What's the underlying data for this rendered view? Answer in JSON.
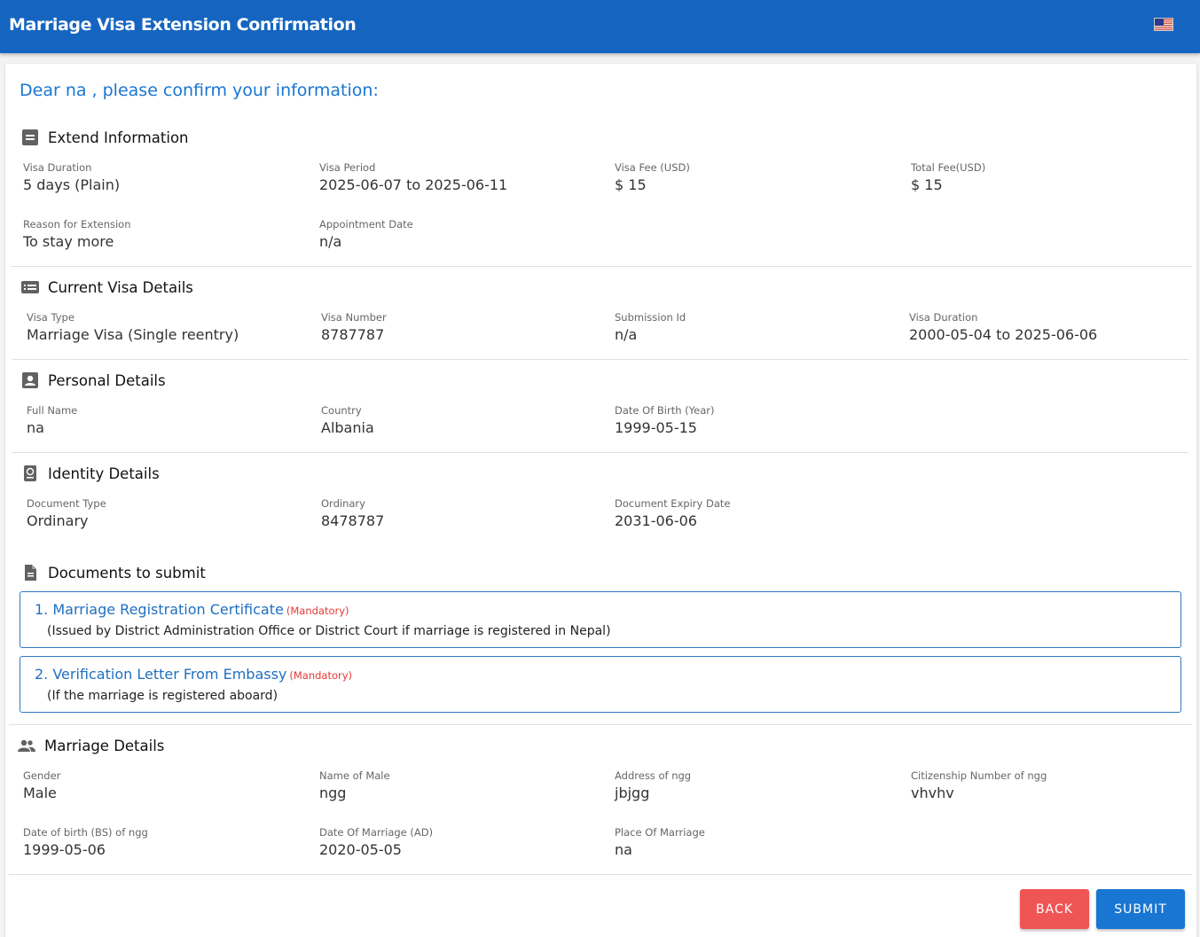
{
  "header": {
    "title": "Marriage Visa Extension Confirmation",
    "language_icon": "us-flag-icon"
  },
  "greeting": "Dear na , please confirm your information:",
  "extend": {
    "heading": "Extend Information",
    "fields": [
      {
        "label": "Visa Duration",
        "value": "5 days (Plain)"
      },
      {
        "label": "Visa Period",
        "value": "2025-06-07 to 2025-06-11"
      },
      {
        "label": "Visa Fee (USD)",
        "value": "$ 15"
      },
      {
        "label": "Total Fee(USD)",
        "value": "$ 15"
      },
      {
        "label": "Reason for Extension",
        "value": "To stay more"
      },
      {
        "label": "Appointment Date",
        "value": "n/a"
      }
    ]
  },
  "current": {
    "heading": "Current Visa Details",
    "fields": [
      {
        "label": "Visa Type",
        "value": "Marriage Visa (Single reentry)"
      },
      {
        "label": "Visa Number",
        "value": "8787787"
      },
      {
        "label": "Submission Id",
        "value": "n/a"
      },
      {
        "label": "Visa Duration",
        "value": "2000-05-04 to 2025-06-06"
      }
    ]
  },
  "personal": {
    "heading": "Personal Details",
    "fields": [
      {
        "label": "Full Name",
        "value": "na"
      },
      {
        "label": "Country",
        "value": "Albania"
      },
      {
        "label": "Date Of Birth (Year)",
        "value": "1999-05-15"
      }
    ]
  },
  "identity": {
    "heading": "Identity Details",
    "fields": [
      {
        "label": "Document Type",
        "value": "Ordinary"
      },
      {
        "label": "Ordinary",
        "value": "8478787"
      },
      {
        "label": "Document Expiry Date",
        "value": "2031-06-06"
      }
    ]
  },
  "documents": {
    "heading": "Documents to submit",
    "items": [
      {
        "title": "1. Marriage Registration Certificate",
        "tag": "(Mandatory)",
        "desc": "(Issued by District Administration Office or District Court if marriage is registered in Nepal)"
      },
      {
        "title": "2. Verification Letter From Embassy",
        "tag": "(Mandatory)",
        "desc": "(If the marriage is registered aboard)"
      }
    ]
  },
  "marriage": {
    "heading": "Marriage Details",
    "fields": [
      {
        "label": "Gender",
        "value": "Male"
      },
      {
        "label": "Name of Male",
        "value": "ngg"
      },
      {
        "label": "Address of ngg",
        "value": "jbjgg"
      },
      {
        "label": "Citizenship Number of ngg",
        "value": "vhvhv"
      },
      {
        "label": "Date of birth (BS) of ngg",
        "value": "1999-05-06"
      },
      {
        "label": "Date Of Marriage (AD)",
        "value": "2020-05-05"
      },
      {
        "label": "Place Of Marriage",
        "value": "na"
      }
    ]
  },
  "actions": {
    "back": "BACK",
    "submit": "SUBMIT"
  },
  "colors": {
    "primary": "#1565c0",
    "link": "#1976d2",
    "back": "#f05555",
    "mandatory": "#e53935"
  }
}
